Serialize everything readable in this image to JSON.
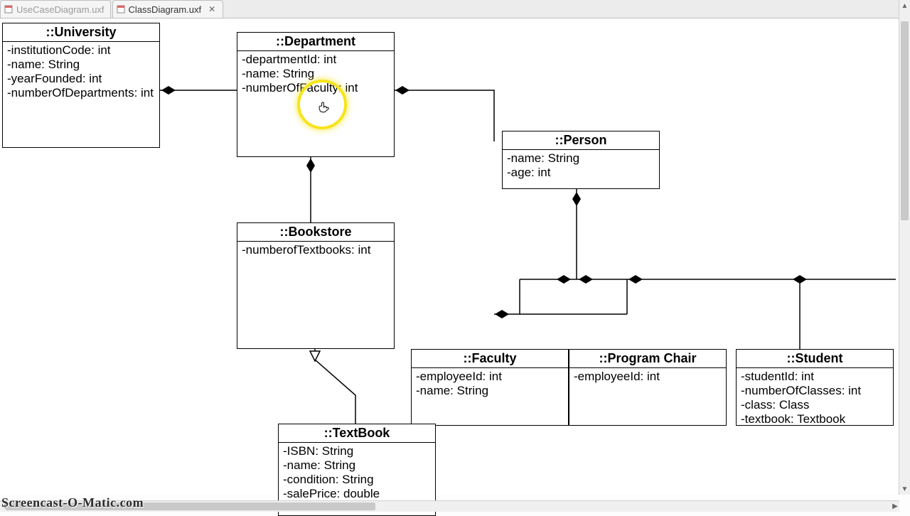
{
  "tabs": {
    "inactive": "UseCaseDiagram.uxf",
    "active": "ClassDiagram.uxf"
  },
  "classes": {
    "university": {
      "title": "::University",
      "attrs": [
        "-institutionCode: int",
        "-name: String",
        "-yearFounded: int",
        "-numberOfDepartments: int"
      ]
    },
    "department": {
      "title": "::Department",
      "attrs": [
        "-departmentId: int",
        "-name: String",
        "-numberOfFaculty: int"
      ]
    },
    "person": {
      "title": "::Person",
      "attrs": [
        "-name: String",
        "-age: int"
      ]
    },
    "bookstore": {
      "title": "::Bookstore",
      "attrs": [
        "-numberofTextbooks: int"
      ]
    },
    "faculty": {
      "title": "::Faculty",
      "attrs": [
        "-employeeId: int",
        "-name: String"
      ]
    },
    "programChair": {
      "title": "::Program Chair",
      "attrs": [
        "-employeeId: int"
      ]
    },
    "student": {
      "title": "::Student",
      "attrs": [
        "-studentId: int",
        "-numberOfClasses: int",
        "-class: Class",
        "-textbook: Textbook"
      ]
    },
    "textbook": {
      "title": "::TextBook",
      "attrs": [
        "-ISBN: String",
        "-name: String",
        "-condition: String",
        "-salePrice: double"
      ]
    }
  },
  "watermark": "Screencast-O-Matic.com"
}
